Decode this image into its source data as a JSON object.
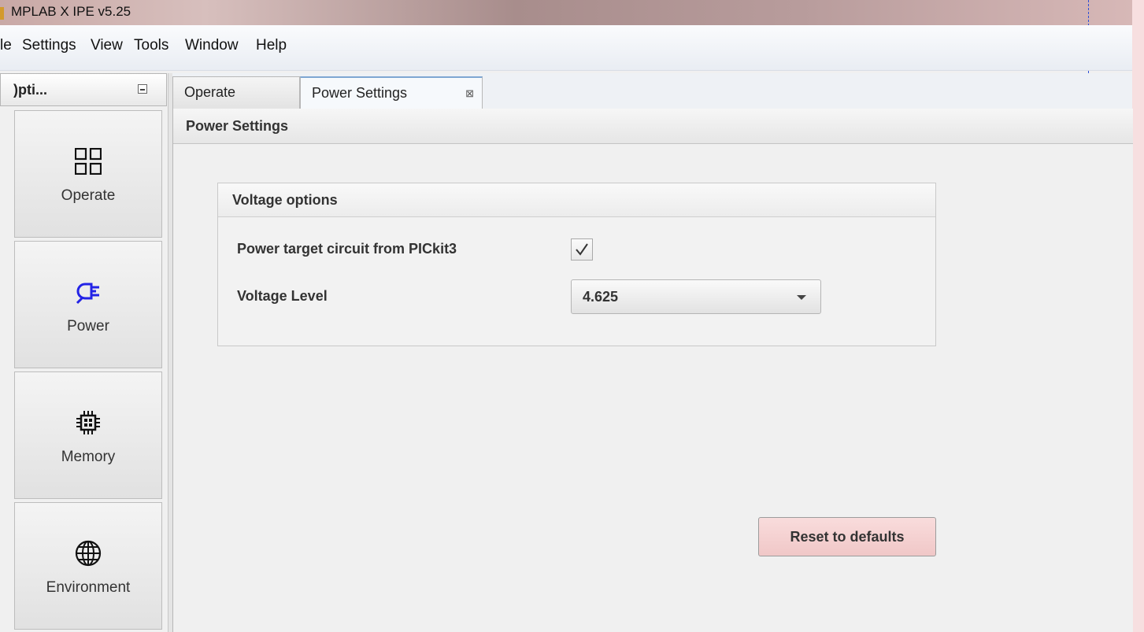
{
  "window": {
    "title": "MPLAB X IPE v5.25"
  },
  "menu": [
    "le",
    "Settings",
    "View",
    "Tools",
    "Window",
    "Help"
  ],
  "left_panel": {
    "title": ")pti...",
    "items": [
      {
        "label": "Operate",
        "icon": "grid-icon"
      },
      {
        "label": "Power",
        "icon": "plug-icon"
      },
      {
        "label": "Memory",
        "icon": "chip-icon"
      },
      {
        "label": "Environment",
        "icon": "globe-icon"
      }
    ]
  },
  "tabs": [
    {
      "label": "Operate",
      "active": false
    },
    {
      "label": "Power Settings",
      "active": true,
      "close_glyph": "⊠"
    }
  ],
  "content": {
    "header": "Power Settings",
    "group_title": "Voltage options",
    "power_label": "Power target circuit from PICkit3",
    "power_checked": true,
    "voltage_label": "Voltage Level",
    "voltage_value": "4.625",
    "reset_label": "Reset to defaults"
  },
  "colors": {
    "accent_tab": "#7ea6d2",
    "reset_bg": "#f3d0d0",
    "power_icon": "#2323e6",
    "guide_line": "#2d4fd6"
  }
}
